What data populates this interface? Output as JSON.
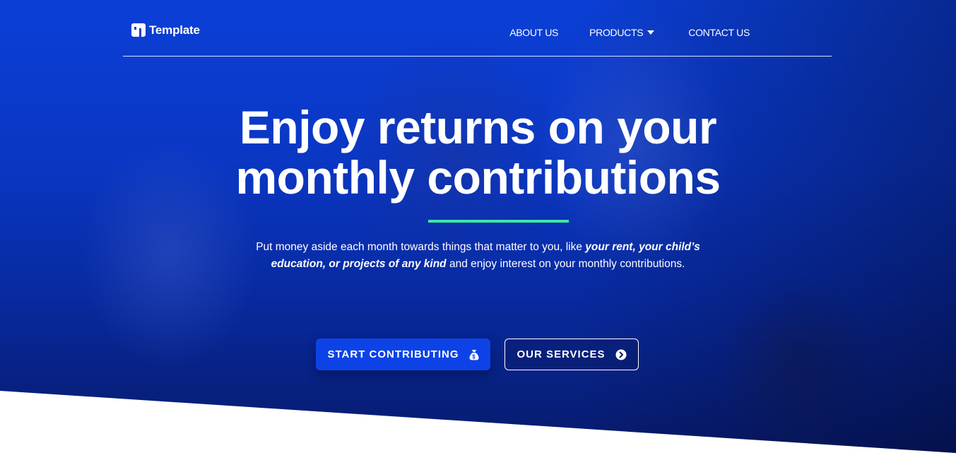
{
  "brand": {
    "name": "Template"
  },
  "nav": {
    "items": [
      {
        "label": "ABOUT US"
      },
      {
        "label": "PRODUCTS",
        "icon": "caret-down-icon"
      },
      {
        "label": "CONTACT US"
      }
    ]
  },
  "hero": {
    "headline_line1": "Enjoy returns on your",
    "headline_line2": "monthly contributions",
    "sub_part1": "Put money aside each month towards things that matter to you, like ",
    "sub_emphasis": "your rent, your child’s education, or projects of any kind",
    "sub_part2": " and enjoy interest on your monthly contributions.",
    "cta_primary": {
      "label": "START CONTRIBUTING",
      "icon": "money-bag-icon"
    },
    "cta_secondary": {
      "label": "OUR SERVICES",
      "icon": "chevron-circle-right-icon"
    }
  },
  "colors": {
    "primary": "#0d43e6",
    "accent_line": "#3ee8a4",
    "overlay_blue": "#0a37c4",
    "text": "#ffffff"
  }
}
